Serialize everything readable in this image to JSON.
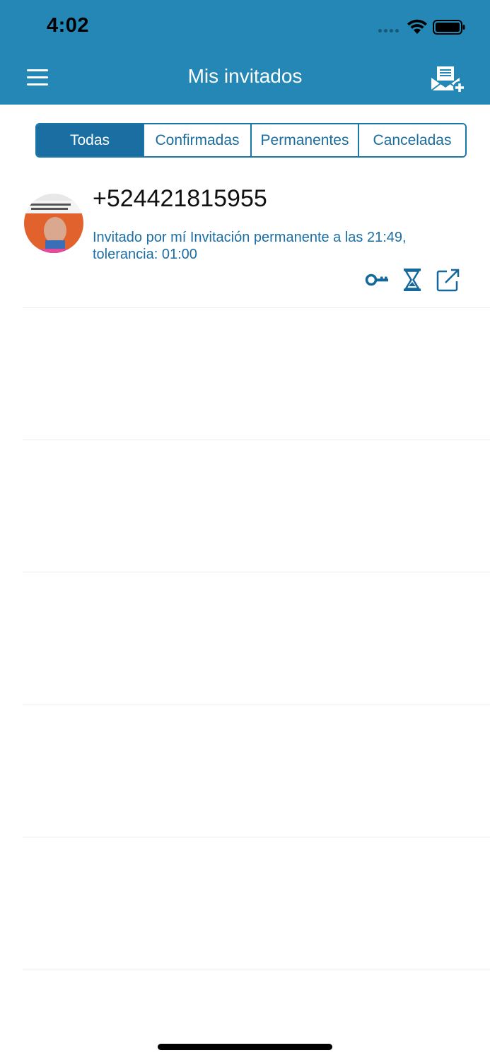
{
  "status_bar": {
    "time": "4:02"
  },
  "nav": {
    "title": "Mis invitados",
    "menu_icon": "hamburger-menu-icon",
    "invite_icon": "envelope-add-icon"
  },
  "tabs": [
    {
      "label": "Todas",
      "active": true
    },
    {
      "label": "Confirmadas",
      "active": false
    },
    {
      "label": "Permanentes",
      "active": false
    },
    {
      "label": "Canceladas",
      "active": false
    }
  ],
  "guests": [
    {
      "phone": "+524421815955",
      "info": "Invitado por mí Invitación permanente  a las 21:49, tolerancia: 01:00",
      "actions": [
        "key-icon",
        "hourglass-icon",
        "share-icon"
      ]
    }
  ],
  "colors": {
    "header": "#2487b5",
    "accent": "#1a6ea1",
    "info_text": "#1c6ea4"
  }
}
